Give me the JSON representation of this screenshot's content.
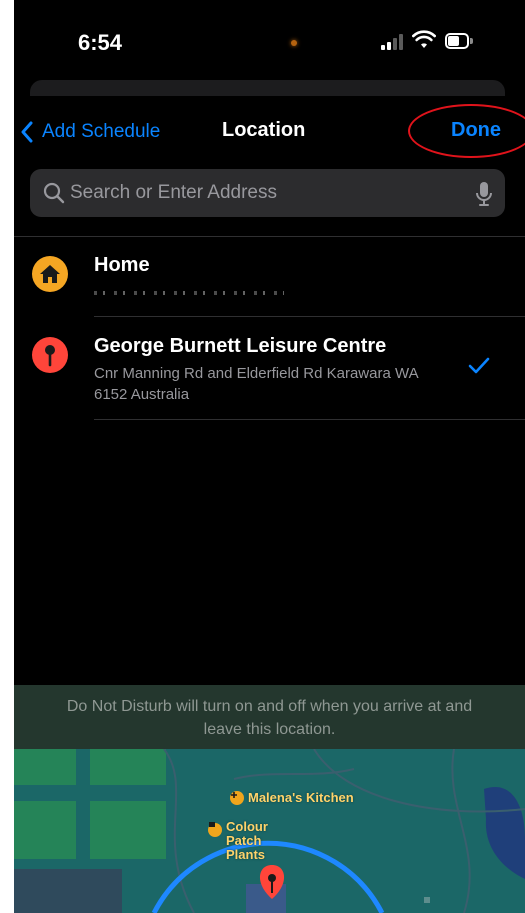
{
  "status_bar": {
    "time": "6:54"
  },
  "nav": {
    "back_label": "Add Schedule",
    "title": "Location",
    "done_label": "Done"
  },
  "search": {
    "placeholder": "Search or Enter Address"
  },
  "locations": [
    {
      "name": "Home",
      "icon": "house-icon",
      "color": "#f5a623",
      "selected": false
    },
    {
      "name": "George Burnett Leisure Centre",
      "address": "Cnr Manning Rd and Elderfield Rd Karawara WA 6152 Australia",
      "icon": "pin-icon",
      "color": "#ff453a",
      "selected": true
    }
  ],
  "info": {
    "message": "Do Not Disturb will turn on and off when you arrive at and leave this location."
  },
  "map": {
    "poi_1": "Malena's Kitchen",
    "poi_2": "Colour Patch Plants"
  },
  "colors": {
    "accent": "#0a84ff",
    "annotation": "#e0131b",
    "map_water": "#1c6a6a"
  }
}
